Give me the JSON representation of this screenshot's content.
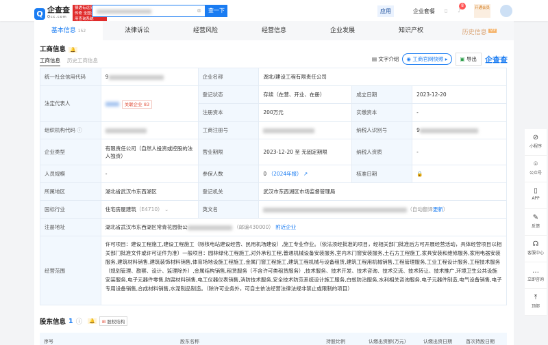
{
  "header": {
    "logo": "企查查",
    "logo_sub": "Qcc.com",
    "slogan": "猜透有远见的商业传奇 全国企业信用查询系统",
    "search_btn": "查一下",
    "app": "应用",
    "links": [
      "企业套餐"
    ],
    "notif_count": "8",
    "vip": "开通会员"
  },
  "tabs": [
    {
      "label": "基本信息",
      "count": "152"
    },
    {
      "label": "法律诉讼"
    },
    {
      "label": "经营风险"
    },
    {
      "label": "经营信息"
    },
    {
      "label": "企业发展"
    },
    {
      "label": "知识产权"
    },
    {
      "label": "历史信息",
      "badge": "VIP"
    }
  ],
  "section": {
    "title": "工商信息",
    "subtabs": [
      "工商信息",
      "历史工商信息"
    ],
    "tools": [
      "文字介绍",
      "工商官网快照",
      "导出"
    ],
    "brand": "企查查"
  },
  "info": {
    "credit_code_label": "统一社会信用代码",
    "credit_code": "9",
    "company_name_label": "企业名称",
    "company_name": "湖北/建设工程有限责任公司",
    "legal_rep_label": "法定代表人",
    "related_label": "关联企业",
    "related_count": "83",
    "reg_status_label": "登记状态",
    "reg_status": "存续（在营、开业、在册）",
    "est_date_label": "成立日期",
    "est_date": "2023-12-20",
    "reg_capital_label": "注册资本",
    "reg_capital": "200万元",
    "paid_capital_label": "实缴资本",
    "paid_capital": "-",
    "org_code_label": "组织机构代码",
    "reg_no_label": "工商注册号",
    "taxpayer_id_label": "纳税人识别号",
    "taxpayer_id": "9",
    "type_label": "企业类型",
    "type": "有限责任公司（自然人投资或控股的法人独资）",
    "term_label": "营业期限",
    "term": "2023-12-20 至 无固定期限",
    "taxpayer_q_label": "纳税人资质",
    "taxpayer_q": "-",
    "staff_label": "人员规模",
    "staff": "-",
    "insured_label": "参保人数",
    "insured": "0",
    "insured_year": "（2024年报）",
    "approve_label": "核准日期",
    "region_label": "所属地区",
    "region": "湖北省武汉市东西湖区",
    "authority_label": "登记机关",
    "authority": "武汉市东西湖区市场监督管理局",
    "industry_label": "国标行业",
    "industry": "住宅房屋建筑",
    "industry_code": "（E4710）",
    "en_name_label": "英文名",
    "en_name_note": "（自动翻译",
    "en_update": "更新",
    "en_close": "）",
    "address_label": "注册地址",
    "address": "湖北省武汉市东西湖区常青花园街公",
    "postcode": "（邮编430000）",
    "nearby": "附近企业",
    "scope_label": "经营范围",
    "scope": "许可项目：建设工程施工,建设工程施工（除核电站建设经营、民用机场建设）,施工专业作业。（依法须经批准的项目，经相关部门批准后方可开展经营活动，具体经营项目以相关部门批准文件或许可证件为准）一般项目：园林绿化工程施工,对外承包工程,普通机械设备安装服务,室内木门窗安装服务,土石方工程施工,家具安装和维修服务,家用电器安装服务,建筑材料销售,建筑装饰材料销售,体育场地设施工程施工,金属门窗工程施工,建筑工程机械与设备租赁,建筑工程用机械销售,工程管理服务,工业工程设计服务,工程技术服务（规划管理、勘察、设计、监理除外）,金属结构销售,租赁服务（不含许可类租赁服务）,技术服务、技术开发、技术咨询、技术交流、技术转让、技术推广,环境卫生公共设施安装服务,电子元器件零售,防腐材料销售,电工仪器仪表销售,消防技术服务,安全技术防范系统设计施工服务,白蚁防治服务,水利相关咨询服务,电子元器件制造,电气设备销售,电子专用设备销售,合成材料销售,水泥制品制造。（除许可业务外，可自主依法经营法律法规非禁止或限制的项目）"
  },
  "shareholders": {
    "title": "股东信息",
    "count": "1",
    "equity": "股权结构",
    "columns": [
      "序号",
      "股东名称",
      "持股比例",
      "认缴出资额(万元)",
      "认缴出资日期",
      "首次持股日期"
    ]
  },
  "sidebar": [
    "小程序",
    "公众号",
    "APP",
    "反馈",
    "客服中心",
    "立即咨询",
    "顶部"
  ]
}
